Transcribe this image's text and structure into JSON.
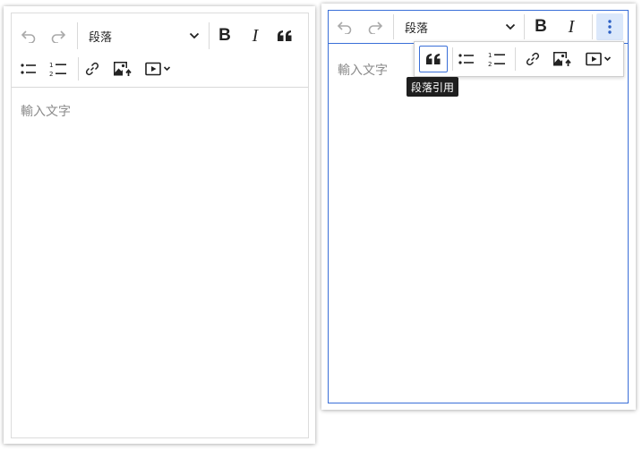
{
  "toolbar": {
    "undo_icon": "undo-icon",
    "redo_icon": "redo-icon",
    "block_format": {
      "selected": "段落"
    },
    "bold_icon": "bold-icon",
    "italic_icon": "italic-icon",
    "quote_icon": "quote-icon",
    "bulleted_list_icon": "bulleted-list-icon",
    "numbered_list_icon": "numbered-list-icon",
    "link_icon": "link-icon",
    "image_icon": "image-upload-icon",
    "media_icon": "media-embed-icon",
    "more_icon": "vertical-dots-icon"
  },
  "left_editor": {
    "placeholder": "輸入文字"
  },
  "right_editor": {
    "placeholder": "輸入文字",
    "tooltip": "段落引用"
  },
  "colors": {
    "accent": "#3a6fd8",
    "tooltip_bg": "#1e1e1e",
    "border": "#d9d9d9",
    "placeholder": "#8a8a8a"
  }
}
